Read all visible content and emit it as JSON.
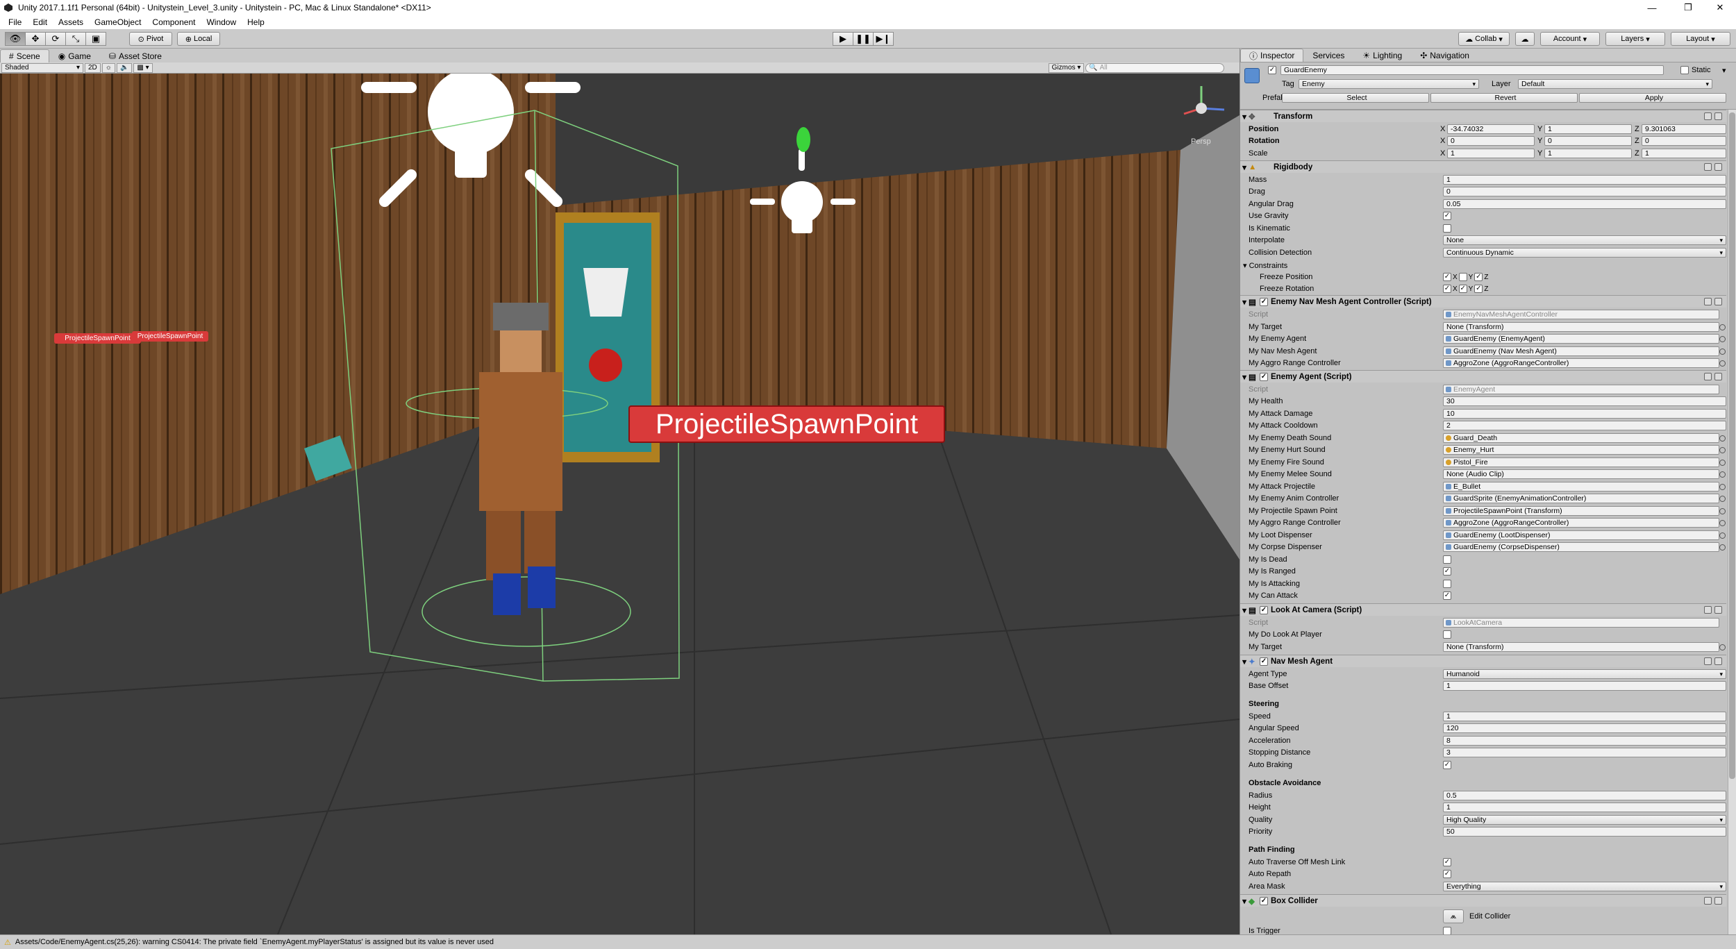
{
  "window": {
    "title": "Unity 2017.1.1f1 Personal (64bit) - Unitystein_Level_3.unity - Unitystein - PC, Mac & Linux Standalone* <DX11>"
  },
  "menu": [
    "File",
    "Edit",
    "Assets",
    "GameObject",
    "Component",
    "Window",
    "Help"
  ],
  "toolbar": {
    "pivot": "Pivot",
    "local": "Local",
    "collab": "Collab",
    "account": "Account",
    "layers": "Layers",
    "layout": "Layout"
  },
  "scene": {
    "tabs": [
      "Scene",
      "Game",
      "Asset Store"
    ],
    "shading": "Shaded",
    "mode2d": "2D",
    "gizmos": "Gizmos",
    "search_placeholder": "All",
    "persp": "Persp",
    "label_big": "ProjectileSpawnPoint",
    "label_small_a": "ProjectileSpawnPoint",
    "label_small_b": "ProjectileSpawnPoint"
  },
  "status": {
    "message": "Assets/Code/EnemyAgent.cs(25,26): warning CS0414: The private field `EnemyAgent.myPlayerStatus' is assigned but its value is never used"
  },
  "inspector": {
    "tabs": [
      "Inspector",
      "Services",
      "Lighting",
      "Navigation"
    ],
    "object_name": "GuardEnemy",
    "static": "Static",
    "tag_label": "Tag",
    "tag": "Enemy",
    "layer_label": "Layer",
    "layer": "Default",
    "prefab_label": "Prefab",
    "prefab_select": "Select",
    "prefab_revert": "Revert",
    "prefab_apply": "Apply",
    "transform": {
      "title": "Transform",
      "position_label": "Position",
      "rotation_label": "Rotation",
      "scale_label": "Scale",
      "position": [
        "-34.74032",
        "1",
        "9.301063"
      ],
      "rotation": [
        "0",
        "0",
        "0"
      ],
      "scale": [
        "1",
        "1",
        "1"
      ]
    },
    "rigidbody": {
      "title": "Rigidbody",
      "rows": [
        [
          "Mass",
          "1"
        ],
        [
          "Drag",
          "0"
        ],
        [
          "Angular Drag",
          "0.05"
        ]
      ],
      "use_gravity": "Use Gravity",
      "is_kinematic": "Is Kinematic",
      "interpolate_label": "Interpolate",
      "interpolate": "None",
      "collision_label": "Collision Detection",
      "collision": "Continuous Dynamic",
      "constraints": "Constraints",
      "freeze_pos": "Freeze Position",
      "freeze_rot": "Freeze Rotation"
    },
    "navctrl": {
      "title": "Enemy Nav Mesh Agent Controller (Script)",
      "script_label": "Script",
      "script": "EnemyNavMeshAgentController",
      "rows": [
        [
          "My Target",
          "None (Transform)"
        ],
        [
          "My Enemy Agent",
          "GuardEnemy (EnemyAgent)"
        ],
        [
          "My Nav Mesh Agent",
          "GuardEnemy (Nav Mesh Agent)"
        ],
        [
          "My Aggro Range Controller",
          "AggroZone (AggroRangeController)"
        ]
      ]
    },
    "enemyagent": {
      "title": "Enemy Agent (Script)",
      "script_label": "Script",
      "script": "EnemyAgent",
      "rows": [
        [
          "My Health",
          "30"
        ],
        [
          "My Attack Damage",
          "10"
        ],
        [
          "My Attack Cooldown",
          "2"
        ]
      ],
      "refs": [
        [
          "My Enemy Death Sound",
          "Guard_Death"
        ],
        [
          "My Enemy Hurt Sound",
          "Enemy_Hurt"
        ],
        [
          "My Enemy Fire Sound",
          "Pistol_Fire"
        ],
        [
          "My Enemy Melee Sound",
          "None (Audio Clip)"
        ],
        [
          "My Attack Projectile",
          "E_Bullet"
        ],
        [
          "My Enemy Anim Controller",
          "GuardSprite (EnemyAnimationController)"
        ],
        [
          "My Projectile Spawn Point",
          "ProjectileSpawnPoint (Transform)"
        ],
        [
          "My Aggro Range Controller",
          "AggroZone (AggroRangeController)"
        ],
        [
          "My Loot Dispenser",
          "GuardEnemy (LootDispenser)"
        ],
        [
          "My Corpse Dispenser",
          "GuardEnemy (CorpseDispenser)"
        ]
      ],
      "bools": [
        [
          "My Is Dead",
          false
        ],
        [
          "My Is Ranged",
          true
        ],
        [
          "My Is Attacking",
          false
        ],
        [
          "My Can Attack",
          true
        ]
      ]
    },
    "lookat": {
      "title": "Look At Camera (Script)",
      "script_label": "Script",
      "script": "LookAtCamera",
      "do_look": "My Do Look At Player",
      "target_label": "My Target",
      "target": "None (Transform)"
    },
    "navagent": {
      "title": "Nav Mesh Agent",
      "agent_type_label": "Agent Type",
      "agent_type": "Humanoid",
      "base_offset_label": "Base Offset",
      "base_offset": "1",
      "steering": "Steering",
      "steer_rows": [
        [
          "Speed",
          "1"
        ],
        [
          "Angular Speed",
          "120"
        ],
        [
          "Acceleration",
          "8"
        ],
        [
          "Stopping Distance",
          "3"
        ]
      ],
      "auto_braking": "Auto Braking",
      "obstacle": "Obstacle Avoidance",
      "radius_label": "Radius",
      "radius": "0.5",
      "height_label": "Height",
      "height": "1",
      "quality_label": "Quality",
      "quality": "High Quality",
      "priority_label": "Priority",
      "priority": "50",
      "pathfinding": "Path Finding",
      "auto_traverse": "Auto Traverse Off Mesh Link",
      "auto_repath": "Auto Repath",
      "area_mask_label": "Area Mask",
      "area_mask": "Everything"
    },
    "boxcollider": {
      "title": "Box Collider",
      "edit": "Edit Collider",
      "is_trigger": "Is Trigger"
    }
  }
}
